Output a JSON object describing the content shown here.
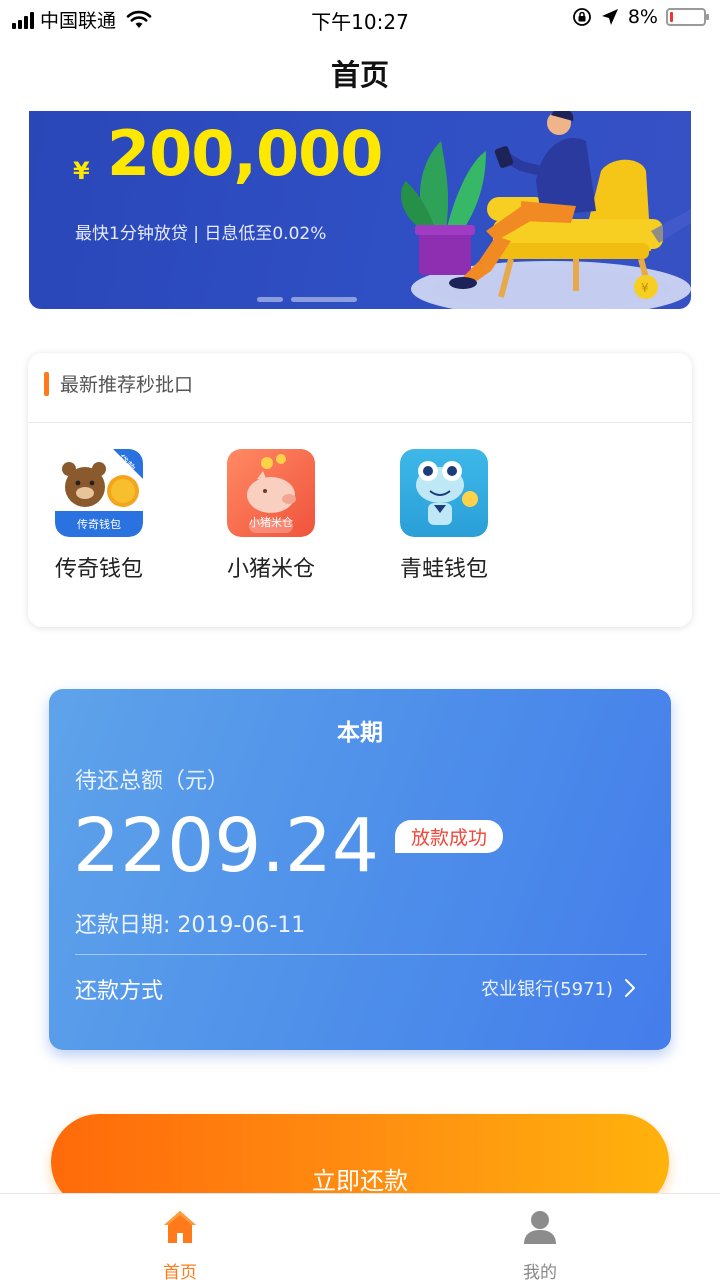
{
  "status_bar": {
    "carrier": "中国联通",
    "time": "下午10:27",
    "battery": "8%",
    "battery_level": 0.08
  },
  "header": {
    "title": "首页"
  },
  "banner": {
    "currency": "¥",
    "amount": "200,000",
    "subtitle": "最快1分钟放贷 | 日息低至0.02%"
  },
  "recommend": {
    "title": "最新推荐秒批口",
    "apps": [
      {
        "name": "传奇钱包",
        "icon": "bear-coin-icon",
        "badge": "贷款",
        "caption": "传奇钱包"
      },
      {
        "name": "小猪米仓",
        "icon": "piggy-bank-icon",
        "caption": "小猪米仓"
      },
      {
        "name": "青蛙钱包",
        "icon": "frog-icon"
      }
    ]
  },
  "bill": {
    "period": "本期",
    "label": "待还总额（元）",
    "amount": "2209.24",
    "badge": "放款成功",
    "due_date": "还款日期: 2019-06-11",
    "method_label": "还款方式",
    "method_value": "农业银行(5971)"
  },
  "pay_button": {
    "label": "立即还款"
  },
  "tab_bar": {
    "tabs": [
      {
        "label": "首页",
        "icon": "home-icon",
        "active": true,
        "color": "#ff7a1a"
      },
      {
        "label": "我的",
        "icon": "person-icon",
        "active": false,
        "color": "#888888"
      }
    ]
  }
}
